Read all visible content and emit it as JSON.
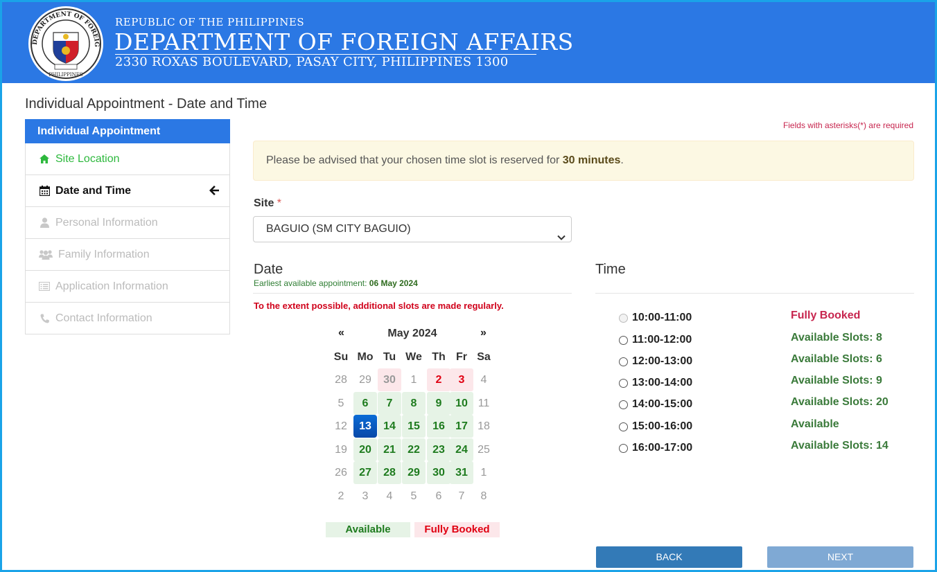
{
  "header": {
    "republic": "REPUBLIC OF THE PHILIPPINES",
    "department": "DEPARTMENT OF FOREIGN AFFAIRS",
    "address": "2330 ROXAS BOULEVARD, PASAY CITY, PHILIPPINES 1300",
    "seal_text": "DEPARTMENT OF FOREIGN AFFAIRS",
    "seal_bottom": "PHILIPPINES"
  },
  "page_title": "Individual Appointment - Date and Time",
  "sidebar": {
    "heading": "Individual Appointment",
    "items": [
      {
        "label": "Site Location",
        "icon": "home-icon",
        "state": "done"
      },
      {
        "label": "Date and Time",
        "icon": "calendar-icon",
        "state": "active"
      },
      {
        "label": "Personal Information",
        "icon": "user-icon",
        "state": "disabled"
      },
      {
        "label": "Family Information",
        "icon": "users-icon",
        "state": "disabled"
      },
      {
        "label": "Application Information",
        "icon": "list-icon",
        "state": "disabled"
      },
      {
        "label": "Contact Information",
        "icon": "phone-icon",
        "state": "disabled"
      }
    ]
  },
  "required_note": "Fields with asterisks(*) are required",
  "alert": {
    "text": "Please be advised that your chosen time slot is reserved for ",
    "bold": "30 minutes",
    "end": "."
  },
  "site": {
    "label": "Site",
    "required_mark": "*",
    "value": "BAGUIO (SM CITY BAGUIO)"
  },
  "date_section": {
    "title": "Date",
    "earliest_label": "Earliest available appointment: ",
    "earliest_value": "06 May 2024",
    "extent_note": "To the extent possible, additional slots are made regularly."
  },
  "calendar": {
    "prev": "«",
    "next": "»",
    "month_label": "May 2024",
    "weekdays": [
      "Su",
      "Mo",
      "Tu",
      "We",
      "Th",
      "Fr",
      "Sa"
    ],
    "weeks": [
      [
        {
          "d": "28",
          "s": "other"
        },
        {
          "d": "29",
          "s": "other"
        },
        {
          "d": "30",
          "s": "disabled"
        },
        {
          "d": "1",
          "s": "other"
        },
        {
          "d": "2",
          "s": "booked"
        },
        {
          "d": "3",
          "s": "booked"
        },
        {
          "d": "4",
          "s": "other"
        }
      ],
      [
        {
          "d": "5",
          "s": "other"
        },
        {
          "d": "6",
          "s": "avail"
        },
        {
          "d": "7",
          "s": "avail"
        },
        {
          "d": "8",
          "s": "avail"
        },
        {
          "d": "9",
          "s": "avail"
        },
        {
          "d": "10",
          "s": "avail"
        },
        {
          "d": "11",
          "s": "other"
        }
      ],
      [
        {
          "d": "12",
          "s": "other"
        },
        {
          "d": "13",
          "s": "sel"
        },
        {
          "d": "14",
          "s": "avail"
        },
        {
          "d": "15",
          "s": "avail"
        },
        {
          "d": "16",
          "s": "avail"
        },
        {
          "d": "17",
          "s": "avail"
        },
        {
          "d": "18",
          "s": "other"
        }
      ],
      [
        {
          "d": "19",
          "s": "other"
        },
        {
          "d": "20",
          "s": "avail"
        },
        {
          "d": "21",
          "s": "avail"
        },
        {
          "d": "22",
          "s": "avail"
        },
        {
          "d": "23",
          "s": "avail"
        },
        {
          "d": "24",
          "s": "avail"
        },
        {
          "d": "25",
          "s": "other"
        }
      ],
      [
        {
          "d": "26",
          "s": "other"
        },
        {
          "d": "27",
          "s": "avail"
        },
        {
          "d": "28",
          "s": "avail"
        },
        {
          "d": "29",
          "s": "avail"
        },
        {
          "d": "30",
          "s": "avail"
        },
        {
          "d": "31",
          "s": "avail"
        },
        {
          "d": "1",
          "s": "other"
        }
      ],
      [
        {
          "d": "2",
          "s": "other"
        },
        {
          "d": "3",
          "s": "other"
        },
        {
          "d": "4",
          "s": "other"
        },
        {
          "d": "5",
          "s": "other"
        },
        {
          "d": "6",
          "s": "other"
        },
        {
          "d": "7",
          "s": "other"
        },
        {
          "d": "8",
          "s": "other"
        }
      ]
    ],
    "legend_available": "Available",
    "legend_booked": "Fully Booked"
  },
  "time_section": {
    "title": "Time",
    "slots": [
      {
        "time": "10:00-11:00",
        "status": "Fully Booked",
        "full": true
      },
      {
        "time": "11:00-12:00",
        "status": "Available Slots: 8",
        "full": false
      },
      {
        "time": "12:00-13:00",
        "status": "Available Slots: 6",
        "full": false
      },
      {
        "time": "13:00-14:00",
        "status": "Available Slots: 9",
        "full": false
      },
      {
        "time": "14:00-15:00",
        "status": "Available Slots: 20",
        "full": false
      },
      {
        "time": "15:00-16:00",
        "status": "Available",
        "full": false
      },
      {
        "time": "16:00-17:00",
        "status": "Available Slots: 14",
        "full": false
      }
    ]
  },
  "buttons": {
    "back": "BACK",
    "next": "NEXT"
  },
  "colors": {
    "header_blue": "#2b78e4",
    "available_green": "#1e7b1e",
    "booked_red": "#e00012",
    "selected_blue": "#0a6cd6"
  }
}
